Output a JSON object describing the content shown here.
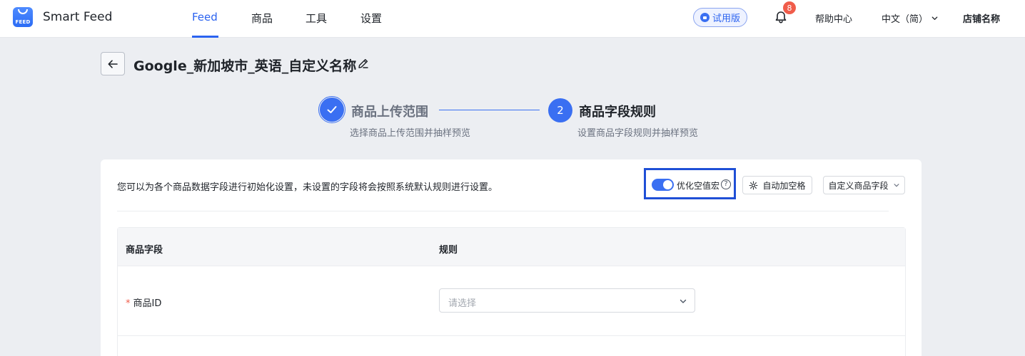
{
  "app": {
    "logo_text": "FEED",
    "name": "Smart Feed"
  },
  "nav": {
    "items": [
      {
        "label": "Feed",
        "active": true
      },
      {
        "label": "商品",
        "active": false
      },
      {
        "label": "工具",
        "active": false
      },
      {
        "label": "设置",
        "active": false
      }
    ]
  },
  "header_right": {
    "trial_label": "试用版",
    "notification_count": "8",
    "help_label": "帮助中心",
    "language_label": "中文（简）",
    "store_label": "店铺名称"
  },
  "page": {
    "title": "Google_新加坡市_英语_自定义名称"
  },
  "steps": [
    {
      "number": "1",
      "title": "商品上传范围",
      "subtitle": "选择商品上传范围并抽样预览",
      "status": "done"
    },
    {
      "number": "2",
      "title": "商品字段规则",
      "subtitle": "设置商品字段规则并抽样预览",
      "status": "current"
    }
  ],
  "settings": {
    "intro": "您可以为各个商品数据字段进行初始化设置，未设置的字段将会按照系统默认规则进行设置。",
    "toggle_label": "优化空值宏",
    "toggle_on": true,
    "auto_space_label": "自动加空格",
    "custom_field_label": "自定义商品字段"
  },
  "table": {
    "headers": [
      "商品字段",
      "规则"
    ],
    "rows": [
      {
        "required": "*",
        "field": "商品ID",
        "placeholder": "请选择"
      }
    ]
  },
  "colors": {
    "accent": "#2b63f0",
    "required": "#f05c4a",
    "highlight": "#1f4fd6"
  }
}
